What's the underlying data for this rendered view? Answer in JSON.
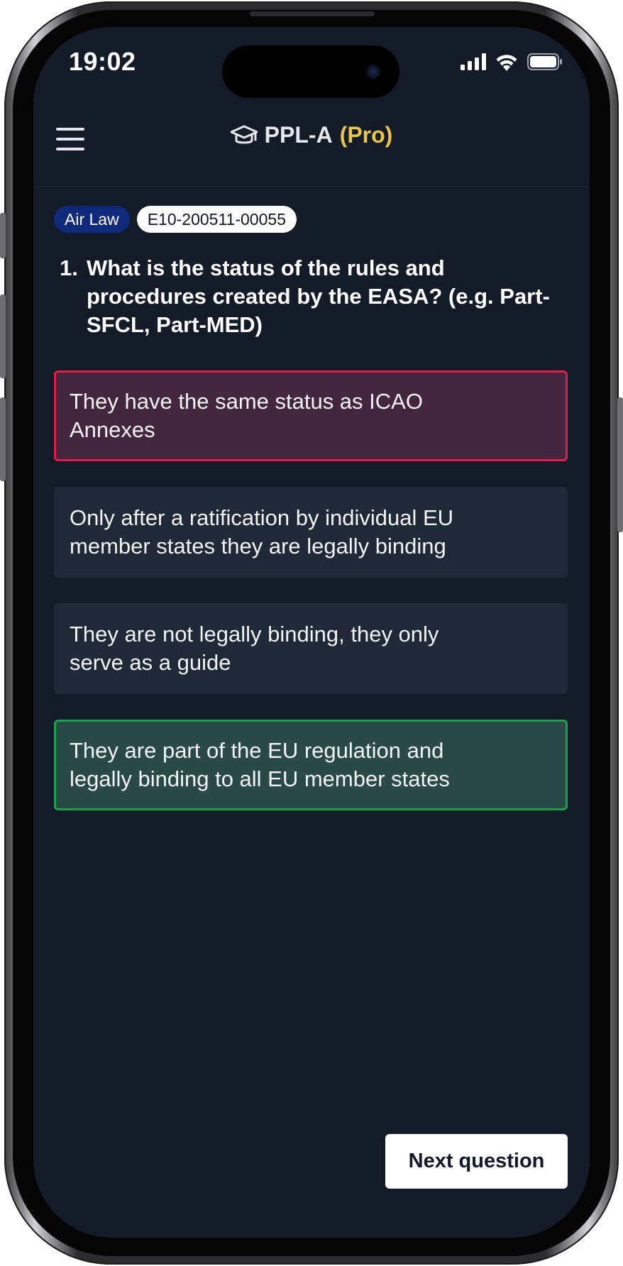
{
  "status_bar": {
    "time": "19:02"
  },
  "header": {
    "menu_icon": "hamburger-menu-icon",
    "title_icon": "graduation-cap-icon",
    "title": "PPL-A",
    "title_badge": "(Pro)"
  },
  "question": {
    "subject_tag": "Air Law",
    "code_tag": "E10-200511-00055",
    "number": "1.",
    "text": "What is the status of the rules and procedures created by the EASA? (e.g. Part-SFCL, Part-MED)",
    "answers": [
      {
        "text": "They have the same status as ICAO Annexes",
        "state": "wrong"
      },
      {
        "text": "Only after a ratification by individual EU member states they are legally binding",
        "state": "neutral"
      },
      {
        "text": "They are not legally binding, they only serve as a guide",
        "state": "neutral"
      },
      {
        "text": "They are part of the EU regulation and legally binding to all EU member states",
        "state": "correct"
      }
    ]
  },
  "footer": {
    "next_label": "Next question"
  },
  "colors": {
    "background": "#131a28",
    "answer_neutral": "#1f2938",
    "wrong_border": "#e11d48",
    "correct_border": "#16a34a",
    "pro_accent": "#e8c547",
    "subject_tag": "#0f2a7a"
  }
}
